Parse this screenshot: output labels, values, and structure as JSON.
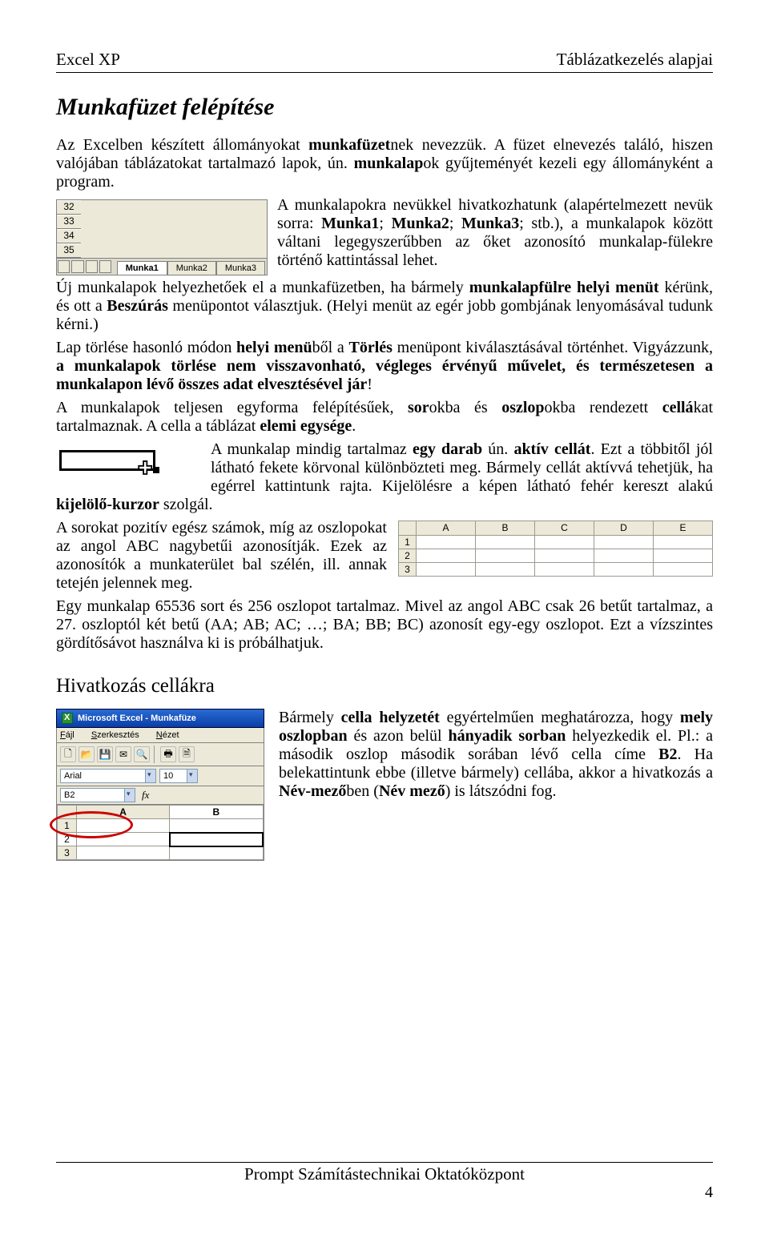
{
  "header": {
    "left": "Excel XP",
    "right": "Táblázatkezelés alapjai"
  },
  "h1": "Munkafüzet felépítése",
  "p1": {
    "a": "Az Excelben készített állományokat ",
    "b": "munkafüzet",
    "c": "nek nevezzük. A füzet elnevezés találó, hiszen valójában táblázatokat tartalmazó lapok, ún. ",
    "d": "munkalap",
    "e": "ok gyűjteményét kezeli egy állományként a program."
  },
  "fig_tabs": {
    "rows": [
      "32",
      "33",
      "34",
      "35"
    ],
    "tabs": [
      "Munka1",
      "Munka2",
      "Munka3"
    ]
  },
  "p2": {
    "a": "A munkalapokra nevükkel hivatkozhatunk (alapértelmezett nevük sorra: ",
    "m1": "Munka1",
    "s1": "; ",
    "m2": "Munka2",
    "s2": "; ",
    "m3": "Munka3",
    "s3": "; stb.), a munkalapok között váltani legegyszerűbben az őket azonosító munkalap-fülekre történő kattintással lehet."
  },
  "p3": {
    "a": "Új munkalapok helyezhetőek el a munkafüzetben, ha bármely ",
    "b": "munkalapfülre helyi menüt",
    "c": " kérünk, és ott a ",
    "d": "Beszúrás",
    "e": " menüpontot választjuk. (Helyi menüt az egér jobb gombjának lenyomásával tudunk kérni.)"
  },
  "p4": {
    "a": "Lap törlése hasonló módon ",
    "b": "helyi menü",
    "c": "ből a ",
    "d": "Törlés",
    "e": " menüpont kiválasztásával történhet. Vigyázzunk, ",
    "f": "a munkalapok törlése nem visszavonható, végleges érvényű művelet, és természetesen a munkalapon lévő összes adat elvesztésével jár",
    "g": "!"
  },
  "p5": {
    "a": "A munkalapok teljesen egyforma felépítésűek, ",
    "b": "sor",
    "c": "okba és ",
    "d": "oszlop",
    "e": "okba rendezett ",
    "f": "cellá",
    "g": "kat tartalmaznak. A cella a táblázat ",
    "h": "elemi egysége",
    "i": "."
  },
  "p6": {
    "a": "A munkalap mindig tartalmaz ",
    "b": "egy darab",
    "c": " ún. ",
    "d": "aktív cellát",
    "e": ". Ezt a többitől jól látható fekete körvonal különbözteti meg. Bármely cellát aktívvá tehetjük, ha egérrel kattintunk rajta. Kijelölésre a képen látható fehér kereszt alakú ",
    "f": "kijelölő-kurzor",
    "g": " szolgál."
  },
  "p7": "A sorokat pozitív egész számok, míg az oszlopokat az angol ABC nagybetűi azonosítják. Ezek az azonosítók a munkaterület bal szélén, ill. annak tetején jelennek meg.",
  "fig_cols": {
    "cols": [
      "A",
      "B",
      "C",
      "D",
      "E"
    ],
    "rows": [
      "1",
      "2",
      "3"
    ]
  },
  "p8": "Egy munkalap 65536 sort és 256 oszlopot tartalmaz. Mivel az angol ABC csak 26 betűt tartalmaz, a 27. oszloptól két betű (AA; AB; AC; …; BA; BB; BC) azonosít egy-egy oszlopot. Ezt a vízszintes gördítősávot használva ki is próbálhatjuk.",
  "h2": "Hivatkozás cellákra",
  "fig_win": {
    "title": "Microsoft Excel - Munkafüze",
    "menus": [
      {
        "u": "F",
        "rest": "ájl"
      },
      {
        "u": "S",
        "rest": "zerkesztés"
      },
      {
        "u": "N",
        "rest": "ézet"
      }
    ],
    "font_name": "Arial",
    "font_size": "10",
    "name_box": "B2",
    "fx_label": "fx",
    "cols": [
      "A",
      "B"
    ],
    "rows": [
      "1",
      "2",
      "3"
    ]
  },
  "p9": {
    "a": "Bármely ",
    "b": "cella helyzetét",
    "c": " egyértelműen meghatározza, hogy ",
    "d": "mely oszlopban",
    "e": " és azon belül ",
    "f": "hányadik sorban",
    "g": " helyezkedik el. Pl.: a második oszlop második sorában lévő cella címe ",
    "h": "B2",
    "i": ". Ha belekattintunk ebbe (illetve bármely) cellába, akkor a hivatkozás a ",
    "j": "Név-mező",
    "k": "ben (",
    "l": "Név mező",
    "m": ") is látszódni fog."
  },
  "footer": {
    "center": "Prompt Számítástechnikai Oktatóközpont",
    "page": "4"
  }
}
